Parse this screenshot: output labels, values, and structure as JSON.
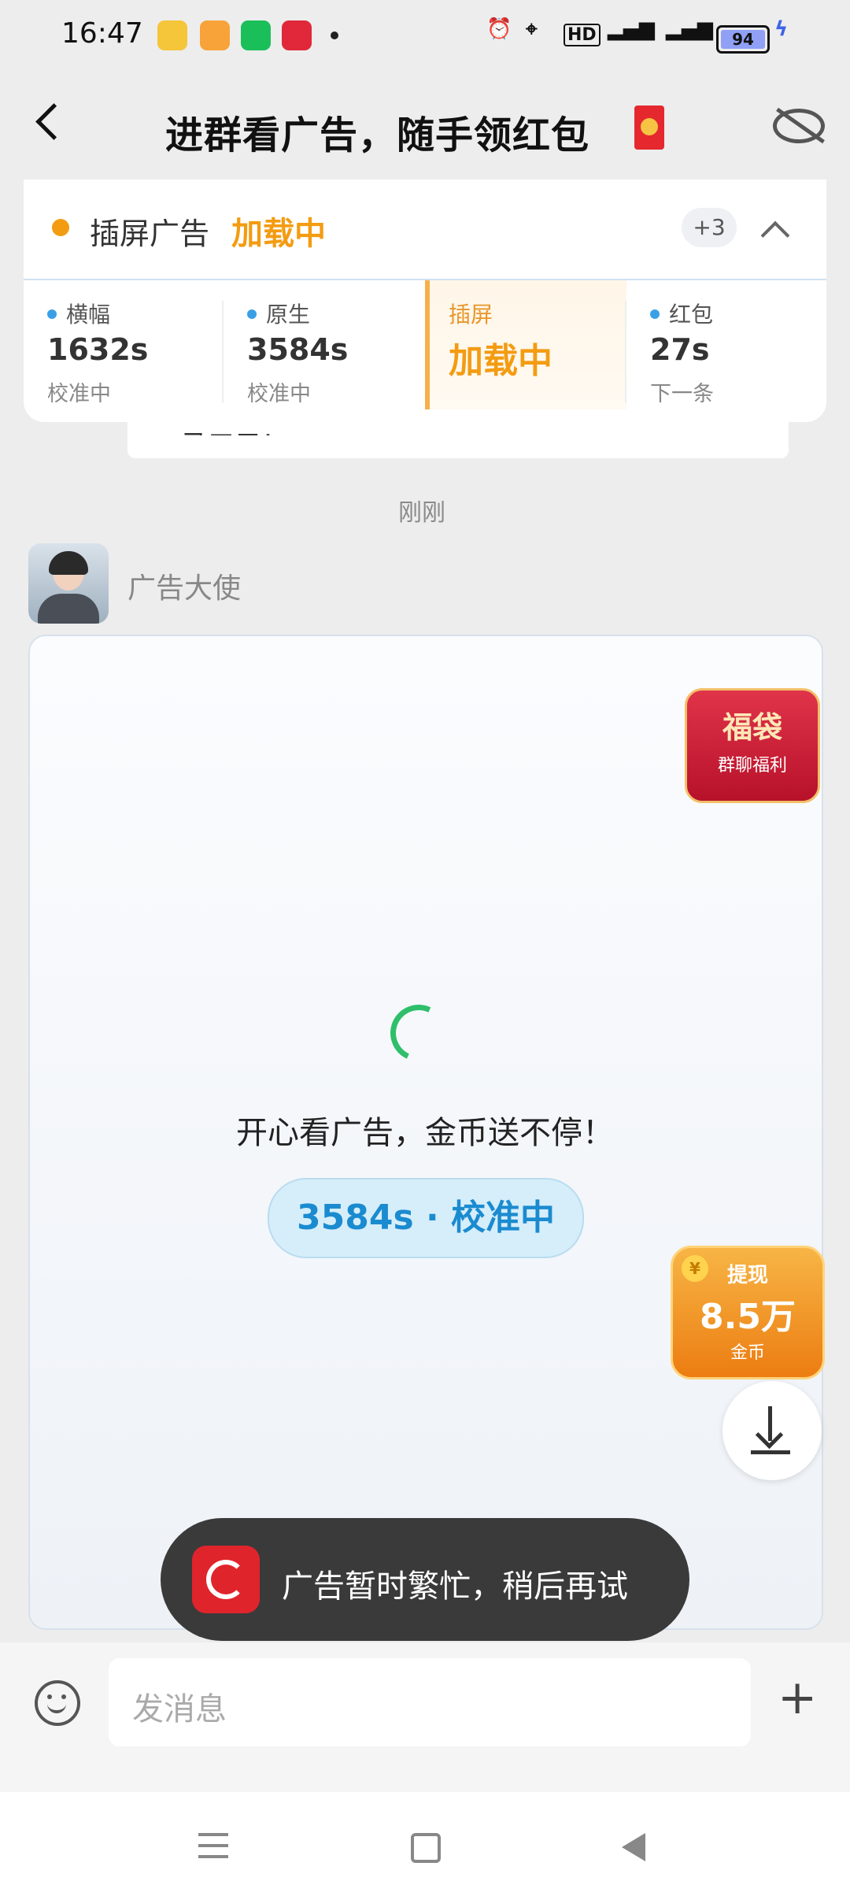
{
  "status_bar": {
    "time": "16:47",
    "battery": "94"
  },
  "header": {
    "title": "进群看广告，随手领红包"
  },
  "panel": {
    "current_label": "插屏广告",
    "current_state": "加载中",
    "badge": "+3",
    "stats": [
      {
        "label": "横幅",
        "value": "1632s",
        "sub": "校准中"
      },
      {
        "label": "原生",
        "value": "3584s",
        "sub": "校准中"
      },
      {
        "label": "插屏",
        "value": "加载中",
        "sub": ""
      },
      {
        "label": "红包",
        "value": "27s",
        "sub": "下一条"
      }
    ]
  },
  "chat": {
    "prev_text": "马三元！",
    "timestamp": "刚刚",
    "sender": "广告大使",
    "message": "开心看广告，金币送不停！",
    "pill": "3584s · 校准中",
    "fudai": {
      "title": "福袋",
      "sub": "群聊福利"
    },
    "withdraw": {
      "title": "提现",
      "amount": "8.5万",
      "unit": "金币"
    },
    "toast": "广告暂时繁忙，稍后再试"
  },
  "input": {
    "placeholder": "发消息"
  },
  "colors": {
    "accent": "#f39c12",
    "pill_text": "#1b8bd0",
    "spinner": "#2fbf6b"
  }
}
